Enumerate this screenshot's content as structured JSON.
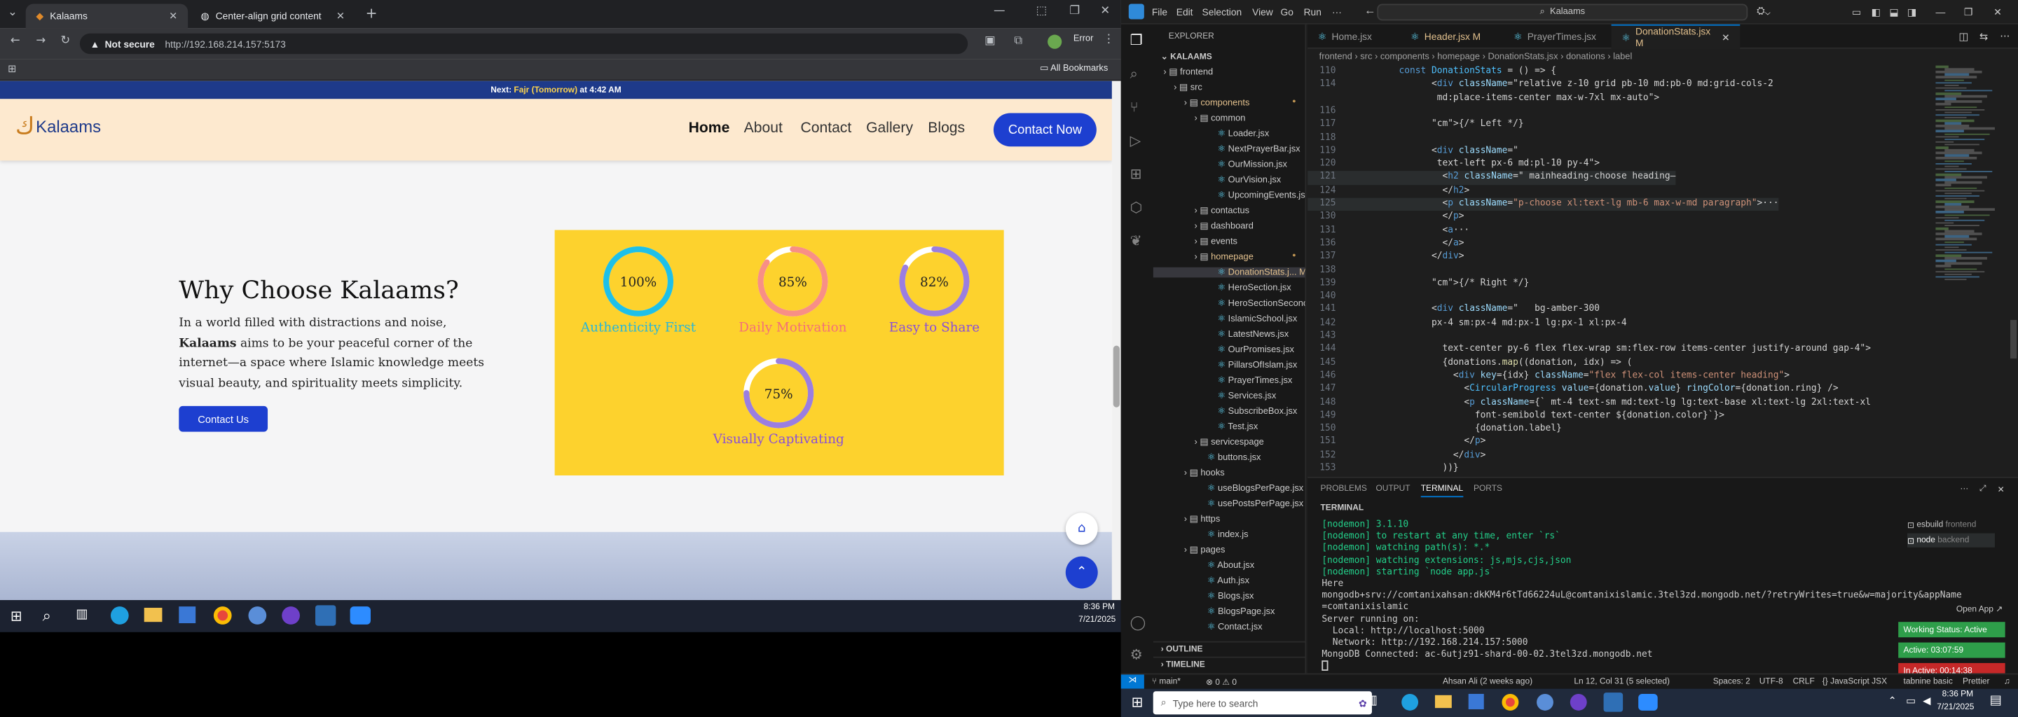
{
  "browser": {
    "tabs": [
      {
        "title": "Kalaams"
      },
      {
        "title": "Center-align grid content"
      }
    ],
    "security": "Not secure",
    "url": "http://192.168.214.157:5173",
    "all_bookmarks": "All Bookmarks",
    "profile_status": "Error"
  },
  "site": {
    "prayer_prefix": "Next: ",
    "prayer_name": "Fajr (Tomorrow)",
    "prayer_suffix": " at 4:42 AM",
    "logo": "Kalaams",
    "nav": [
      "Home",
      "About",
      "Contact",
      "Gallery",
      "Blogs"
    ],
    "cta": "Contact Now",
    "hero_title": "Why Choose Kalaams?",
    "hero_text_1": "In a world filled with distractions and noise, ",
    "hero_bold": "Kalaams",
    "hero_text_2": " aims to be your peaceful corner of the internet—a space where Islamic knowledge meets visual beauty, and spirituality meets simplicity.",
    "hero_button": "Contact Us",
    "stats": [
      {
        "value": "100%",
        "label": "Authenticity First",
        "color": "#29b6d8",
        "ring": "#1ec0e8",
        "pct": 100
      },
      {
        "value": "85%",
        "label": "Daily Motivation",
        "color": "#f36f79",
        "ring": "#f88f86",
        "pct": 85
      },
      {
        "value": "82%",
        "label": "Easy to Share",
        "color": "#8a4fd8",
        "ring": "#9b7ee0",
        "pct": 82
      },
      {
        "value": "75%",
        "label": "Visually Captivating",
        "color": "#8a4fd8",
        "ring": "#9b7ee0",
        "pct": 75
      }
    ]
  },
  "taskbar_left": {
    "time": "8:36 PM",
    "date": "7/21/2025"
  },
  "vscode": {
    "menu": [
      "File",
      "Edit",
      "Selection",
      "View",
      "Go",
      "Run",
      "···"
    ],
    "search": "Kalaams",
    "explorer_title": "EXPLORER",
    "workspace": "KALAAMS",
    "tree": [
      {
        "name": "frontend",
        "depth": 1,
        "folder": true
      },
      {
        "name": "src",
        "depth": 2,
        "folder": true
      },
      {
        "name": "components",
        "depth": 3,
        "folder": true,
        "modified": true
      },
      {
        "name": "common",
        "depth": 4,
        "folder": true
      },
      {
        "name": "Loader.jsx",
        "depth": 5
      },
      {
        "name": "NextPrayerBar.jsx",
        "depth": 5
      },
      {
        "name": "OurMission.jsx",
        "depth": 5
      },
      {
        "name": "OurVision.jsx",
        "depth": 5
      },
      {
        "name": "UpcomingEvents.jsx",
        "depth": 5
      },
      {
        "name": "contactus",
        "depth": 4,
        "folder": true
      },
      {
        "name": "dashboard",
        "depth": 4,
        "folder": true
      },
      {
        "name": "events",
        "depth": 4,
        "folder": true
      },
      {
        "name": "homepage",
        "depth": 4,
        "folder": true,
        "modified": true
      },
      {
        "name": "DonationStats.j... M",
        "depth": 5,
        "selected": true
      },
      {
        "name": "HeroSection.jsx",
        "depth": 5
      },
      {
        "name": "HeroSectionSecond.j...",
        "depth": 5
      },
      {
        "name": "IslamicSchool.jsx",
        "depth": 5
      },
      {
        "name": "LatestNews.jsx",
        "depth": 5
      },
      {
        "name": "OurPromises.jsx",
        "depth": 5
      },
      {
        "name": "PillarsOfIslam.jsx",
        "depth": 5
      },
      {
        "name": "PrayerTimes.jsx",
        "depth": 5
      },
      {
        "name": "Services.jsx",
        "depth": 5
      },
      {
        "name": "SubscribeBox.jsx",
        "depth": 5
      },
      {
        "name": "Test.jsx",
        "depth": 5
      },
      {
        "name": "servicespage",
        "depth": 4,
        "folder": true
      },
      {
        "name": "buttons.jsx",
        "depth": 4
      },
      {
        "name": "hooks",
        "depth": 3,
        "folder": true
      },
      {
        "name": "useBlogsPerPage.jsx",
        "depth": 4
      },
      {
        "name": "usePostsPerPage.jsx",
        "depth": 4
      },
      {
        "name": "https",
        "depth": 3,
        "folder": true
      },
      {
        "name": "index.js",
        "depth": 4
      },
      {
        "name": "pages",
        "depth": 3,
        "folder": true
      },
      {
        "name": "About.jsx",
        "depth": 4
      },
      {
        "name": "Auth.jsx",
        "depth": 4
      },
      {
        "name": "Blogs.jsx",
        "depth": 4
      },
      {
        "name": "BlogsPage.jsx",
        "depth": 4
      },
      {
        "name": "Contact.jsx",
        "depth": 4
      }
    ],
    "outline": "OUTLINE",
    "timeline": "TIMELINE",
    "editor_tabs": [
      {
        "name": "Home.jsx",
        "active": false
      },
      {
        "name": "Header.jsx M",
        "active": false
      },
      {
        "name": "PrayerTimes.jsx",
        "active": false
      },
      {
        "name": "DonationStats.jsx M",
        "active": true
      }
    ],
    "breadcrumb": "frontend › src › components › homepage › DonationStats.jsx › donations › label",
    "code": [
      {
        "n": "110",
        "t": "const DonationStats = () => {"
      },
      {
        "n": "114",
        "t": "      <div className=\"relative z-10 grid pb-10 md:pb-0 md:grid-cols-2"
      },
      {
        "n": "",
        "t": "       md:place-items-center max-w-7xl mx-auto\">"
      },
      {
        "n": "116",
        "t": ""
      },
      {
        "n": "117",
        "t": "      {/* Left */}"
      },
      {
        "n": "118",
        "t": ""
      },
      {
        "n": "119",
        "t": "      <div className=\""
      },
      {
        "n": "120",
        "t": "       text-left px-6 md:pl-10 py-4\">"
      },
      {
        "n": "121",
        "t": "        <h2 className=\" mainheading-choose heading—"
      },
      {
        "n": "124",
        "t": "        </h2>"
      },
      {
        "n": "125",
        "t": "        <p className=\"p-choose xl:text-lg mb-6 max-w-md paragraph\">···"
      },
      {
        "n": "130",
        "t": "        </p>"
      },
      {
        "n": "131",
        "t": "        <a···"
      },
      {
        "n": "136",
        "t": "        </a>"
      },
      {
        "n": "137",
        "t": "      </div>"
      },
      {
        "n": "138",
        "t": ""
      },
      {
        "n": "139",
        "t": "      {/* Right */}"
      },
      {
        "n": "140",
        "t": ""
      },
      {
        "n": "141",
        "t": "      <div className=\"   bg-amber-300"
      },
      {
        "n": "142",
        "t": "      px-4 sm:px-4 md:px-1 lg:px-1 xl:px-4"
      },
      {
        "n": "143",
        "t": ""
      },
      {
        "n": "144",
        "t": "        text-center py-6 flex flex-wrap sm:flex-row items-center justify-around gap-4\">"
      },
      {
        "n": "145",
        "t": "        {donations.map((donation, idx) => ("
      },
      {
        "n": "146",
        "t": "          <div key={idx} className=\"flex flex-col items-center heading\">"
      },
      {
        "n": "147",
        "t": "            <CircularProgress value={donation.value} ringColor={donation.ring} />"
      },
      {
        "n": "148",
        "t": "            <p className={` mt-4 text-sm md:text-lg lg:text-base xl:text-lg 2xl:text-xl"
      },
      {
        "n": "149",
        "t": "              font-semibold text-center ${donation.color}`}>"
      },
      {
        "n": "150",
        "t": "              {donation.label}"
      },
      {
        "n": "151",
        "t": "            </p>"
      },
      {
        "n": "152",
        "t": "          </div>"
      },
      {
        "n": "153",
        "t": "        ))}"
      }
    ],
    "panel_tabs": [
      "PROBLEMS",
      "OUTPUT",
      "TERMINAL",
      "PORTS"
    ],
    "terminal_title": "TERMINAL",
    "terminal": [
      {
        "t": "[nodemon] 3.1.10",
        "g": true
      },
      {
        "t": "[nodemon] to restart at any time, enter `rs`",
        "g": true
      },
      {
        "t": "[nodemon] watching path(s): *.*",
        "g": true
      },
      {
        "t": "[nodemon] watching extensions: js,mjs,cjs,json",
        "g": true
      },
      {
        "t": "[nodemon] starting `node app.js`",
        "g": true
      },
      {
        "t": "Here",
        "g": false
      },
      {
        "t": "mongodb+srv://comtanixahsan:dkKM4r6tTd66224uL@comtanixislamic.3tel3zd.mongodb.net/?retryWrites=true&w=majority&appName",
        "g": false
      },
      {
        "t": "=comtanixislamic",
        "g": false
      },
      {
        "t": "Server running on:",
        "g": false
      },
      {
        "t": "  Local: http://localhost:5000",
        "g": false
      },
      {
        "t": "  Network: http://192.168.214.157:5000",
        "g": false
      },
      {
        "t": "MongoDB Connected: ac-6utjz91-shard-00-02.3tel3zd.mongodb.net",
        "g": false
      }
    ],
    "terminals": [
      {
        "name": "esbuild",
        "sub": "frontend"
      },
      {
        "name": "node",
        "sub": "backend"
      }
    ],
    "open_app": "Open App ↗",
    "badges": [
      {
        "text": "Working Status: Active",
        "color": "#2e9e4a"
      },
      {
        "text": "Active: 03:07:59",
        "color": "#2e9e4a"
      },
      {
        "text": "In Active: 00:14:38",
        "color": "#c62828"
      }
    ],
    "status": {
      "branch": "main*",
      "errors": "⊗ 0 ⚠ 0",
      "blame": "Ahsan Ali (2 weeks ago)",
      "position": "Ln 12, Col 31 (5 selected)",
      "spaces": "Spaces: 2",
      "encoding": "UTF-8",
      "eol": "CRLF",
      "lang": "{} JavaScript JSX",
      "tailwind": "tabnine basic",
      "prettier": "Prettier"
    }
  },
  "taskbar_right": {
    "search": "Type here to search",
    "time": "8:36 PM",
    "date": "7/21/2025"
  }
}
